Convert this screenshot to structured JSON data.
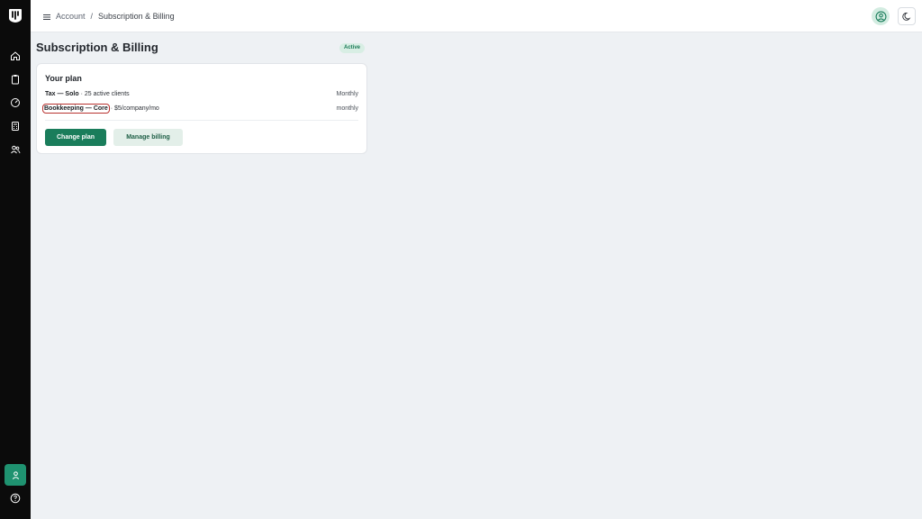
{
  "breadcrumb": {
    "parent": "Account",
    "separator": "/",
    "current": "Subscription & Billing"
  },
  "page": {
    "title": "Subscription & Billing",
    "status": "Active"
  },
  "plan_card": {
    "title": "Your plan",
    "plans": [
      {
        "name": "Tax — Solo",
        "detail": "· 25 active clients",
        "frequency": "Monthly"
      },
      {
        "name": "Bookkeeping — Core",
        "detail": "· $5/company/mo",
        "frequency": "monthly"
      }
    ],
    "change_plan_label": "Change plan",
    "manage_billing_label": "Manage billing"
  },
  "sidebar": {
    "items": [
      "home-icon",
      "clipboard-icon",
      "gauge-icon",
      "calculator-icon",
      "users-icon"
    ],
    "bottom": [
      "user-icon",
      "help-icon"
    ]
  },
  "colors": {
    "accent": "#1a7d5b",
    "sidebar_bg": "#0b0b0b",
    "highlight": "#b8322f"
  }
}
